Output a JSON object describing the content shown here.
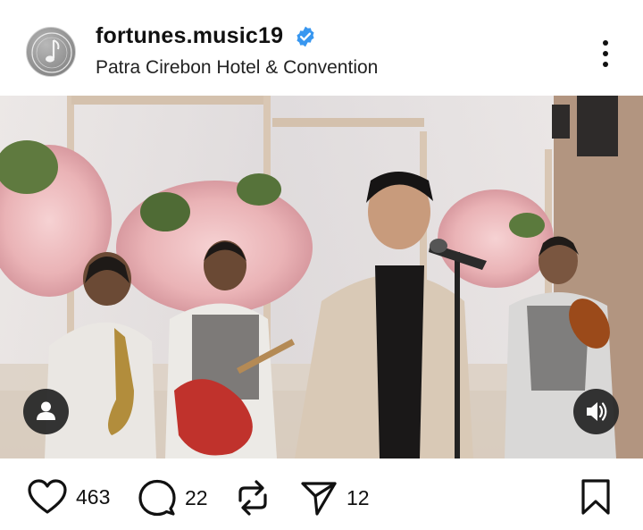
{
  "post": {
    "username": "fortunes.music19",
    "location": "Patra Cirebon Hotel & Convention",
    "verified": true,
    "avatar_icon": "music-note-disc-icon"
  },
  "media": {
    "type": "video",
    "description_icons": [
      "user-tag-icon",
      "sound-on-icon"
    ]
  },
  "actions": {
    "like_count": "463",
    "comment_count": "22",
    "share_count": "12"
  },
  "colors": {
    "verified_blue": "#3897f0",
    "text": "#111111",
    "overlay_button": "#2a2a2a"
  }
}
